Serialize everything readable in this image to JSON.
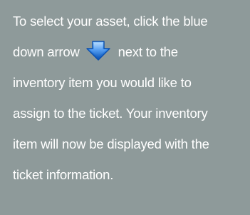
{
  "instruction": {
    "line1": "To select your asset, click the blue",
    "line2_before_icon": "down arrow",
    "line2_after_icon": "next to the",
    "line3": "inventory item you would like to",
    "line4": "assign to the ticket. Your inventory",
    "line5": "item will now be displayed with the",
    "line6": "ticket information."
  },
  "icon": {
    "name": "blue-down-arrow-icon",
    "color": "#1f6fd6"
  }
}
